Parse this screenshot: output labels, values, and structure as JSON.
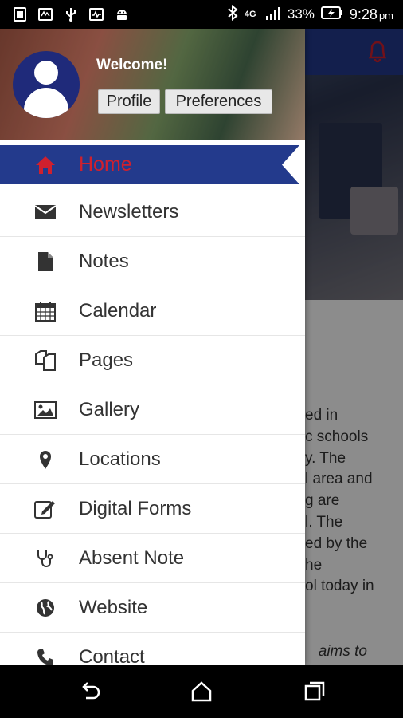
{
  "status_bar": {
    "left_icons": [
      "sim-card-icon",
      "lte-icon",
      "usb-icon",
      "activity-icon",
      "android-icon"
    ],
    "network": "4G",
    "battery": "33%",
    "time": "9:28",
    "ampm": "pm"
  },
  "drawer": {
    "welcome": "Welcome!",
    "profile_button": "Profile",
    "preferences_button": "Preferences",
    "items": [
      {
        "label": "Home",
        "icon": "home-icon",
        "active": true
      },
      {
        "label": "Newsletters",
        "icon": "envelope-icon"
      },
      {
        "label": "Notes",
        "icon": "document-icon"
      },
      {
        "label": "Calendar",
        "icon": "calendar-icon"
      },
      {
        "label": "Pages",
        "icon": "copy-pages-icon"
      },
      {
        "label": "Gallery",
        "icon": "image-icon"
      },
      {
        "label": "Locations",
        "icon": "map-pin-icon"
      },
      {
        "label": "Digital Forms",
        "icon": "edit-form-icon"
      },
      {
        "label": "Absent Note",
        "icon": "stethoscope-icon"
      },
      {
        "label": "Website",
        "icon": "globe-icon"
      },
      {
        "label": "Contact",
        "icon": "phone-icon"
      }
    ],
    "active_color": "#d0202e",
    "active_bg": "#233a8c"
  },
  "background_page": {
    "text_lines": [
      "ed in",
      "c schools",
      "y. The",
      "l area and",
      "g are",
      "l. The",
      "ed by the",
      "he",
      "ol today in"
    ],
    "italic_line": "aims to"
  },
  "nav_bar": {
    "buttons": [
      "back-icon",
      "home-nav-icon",
      "recents-icon"
    ]
  }
}
